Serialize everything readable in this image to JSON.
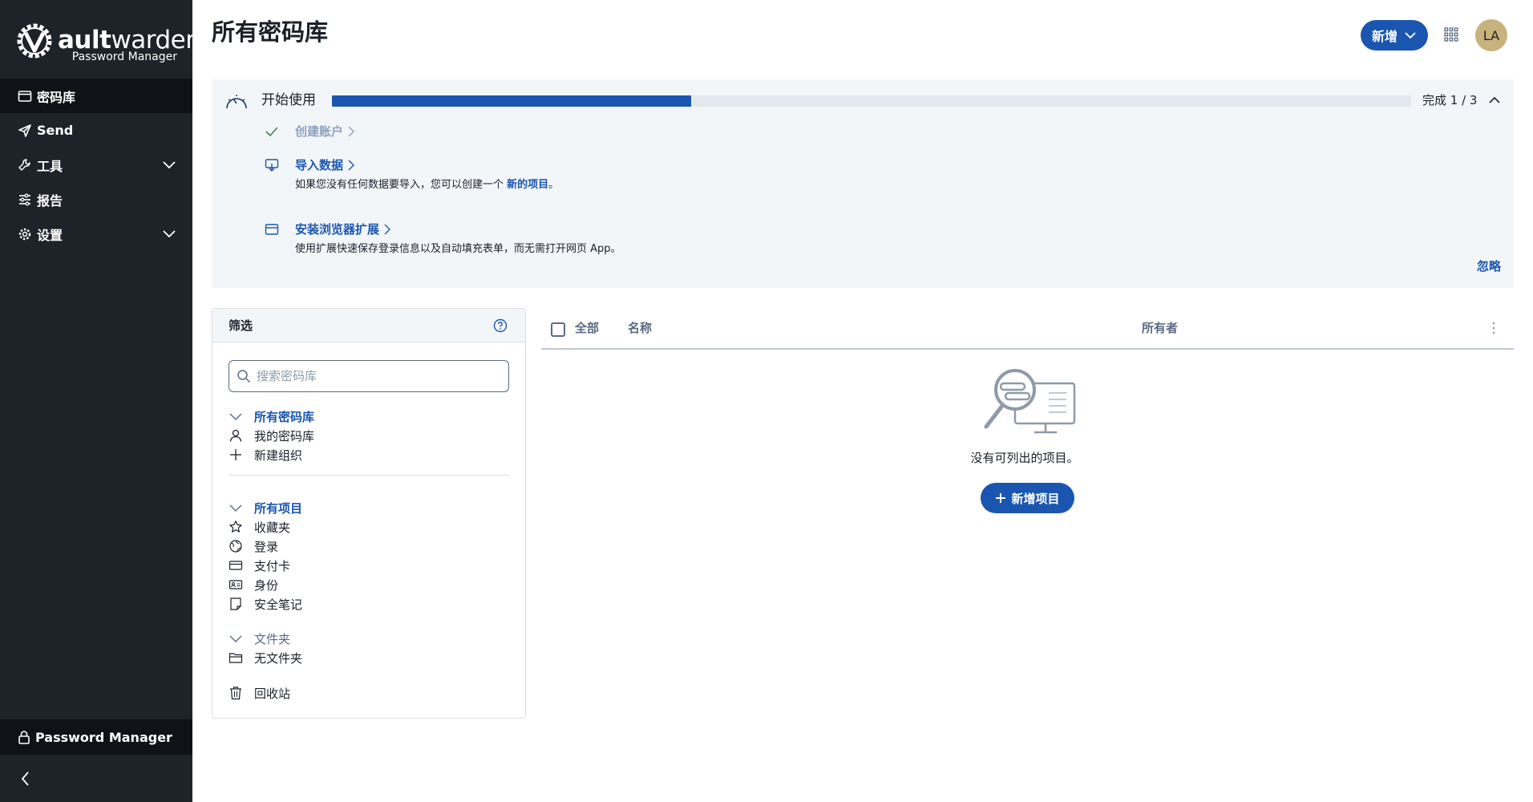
{
  "brand": {
    "logo_first": "V",
    "logo_bold": "ault",
    "logo_light": "warden",
    "subtitle": "Password Manager"
  },
  "sidebar": {
    "items": [
      {
        "label": "密码库",
        "icon": "vault-icon",
        "active": true
      },
      {
        "label": "Send",
        "icon": "send-icon"
      },
      {
        "label": "工具",
        "icon": "wrench-icon",
        "expandable": true
      },
      {
        "label": "报告",
        "icon": "sliders-icon"
      },
      {
        "label": "设置",
        "icon": "gear-icon",
        "expandable": true
      }
    ],
    "footer_label": "Password Manager",
    "collapse_icon": "chevron-left-icon"
  },
  "header": {
    "title": "所有密码库",
    "new_button": "新增",
    "avatar_initials": "LA",
    "avatar_color": "#c8b27d"
  },
  "onboarding": {
    "title": "开始使用",
    "progress_fraction": 0.333,
    "count_text": "完成 1 / 3",
    "tasks": [
      {
        "label": "创建账户",
        "done": true
      },
      {
        "label": "导入数据",
        "desc_before": "如果您没有任何数据要导入，您可以创建一个 ",
        "desc_link": "新的项目",
        "desc_after": "。"
      },
      {
        "label": "安装浏览器扩展",
        "desc": "使用扩展快速保存登录信息以及自动填充表单，而无需打开网页 App。"
      }
    ],
    "dismiss": "忽略"
  },
  "filter": {
    "title": "筛选",
    "search_placeholder": "搜索密码库",
    "vaults": {
      "head": "所有密码库",
      "items": [
        "我的密码库",
        "新建组织"
      ]
    },
    "types": {
      "head": "所有项目",
      "items": [
        "收藏夹",
        "登录",
        "支付卡",
        "身份",
        "安全笔记"
      ]
    },
    "folders": {
      "head": "文件夹",
      "items": [
        "无文件夹"
      ]
    },
    "trash": "回收站"
  },
  "table": {
    "col_all": "全部",
    "col_name": "名称",
    "col_owner": "所有者",
    "empty_text": "没有可列出的项目。",
    "add_button": "新增项目"
  },
  "colors": {
    "sidebar_bg": "#1e2329",
    "accent": "#1a56b0",
    "panel_bg": "#f3f6f9"
  }
}
